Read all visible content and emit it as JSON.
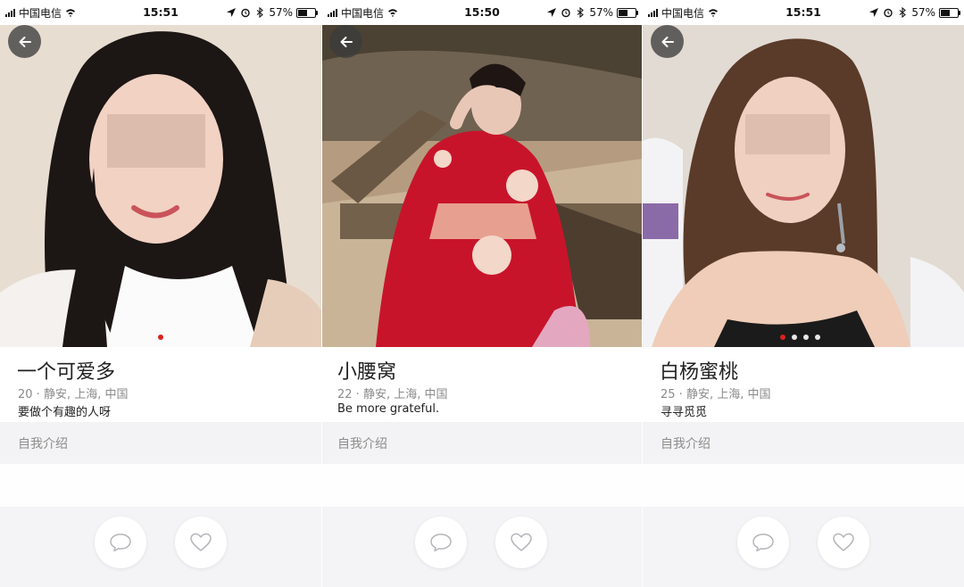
{
  "screens": [
    {
      "status": {
        "carrier": "中国电信",
        "time": "15:51",
        "battery": "57%",
        "battery_level": 0.57
      },
      "icons": {
        "back": "arrow-left-icon",
        "chat": "chat-bubble-icon",
        "like": "heart-icon"
      },
      "profile": {
        "name": "一个可爱多",
        "meta": "20 · 静安, 上海, 中国",
        "bio": "要做个有趣的人呀",
        "intro_label": "自我介绍"
      },
      "photo_dots": {
        "count": 1,
        "active": 0
      }
    },
    {
      "status": {
        "carrier": "中国电信",
        "time": "15:50",
        "battery": "57%",
        "battery_level": 0.57
      },
      "icons": {
        "back": "arrow-left-icon",
        "chat": "chat-bubble-icon",
        "like": "heart-icon"
      },
      "profile": {
        "name": "小腰窝",
        "meta": "22 · 静安, 上海, 中国",
        "bio": "Be more grateful.",
        "intro_label": "自我介绍"
      },
      "photo_dots": {
        "count": 0,
        "active": -1
      }
    },
    {
      "status": {
        "carrier": "中国电信",
        "time": "15:51",
        "battery": "57%",
        "battery_level": 0.57
      },
      "icons": {
        "back": "arrow-left-icon",
        "chat": "chat-bubble-icon",
        "like": "heart-icon"
      },
      "profile": {
        "name": "白杨蜜桃",
        "meta": "25 · 静安, 上海, 中国",
        "bio": "寻寻觅觅",
        "intro_label": "自我介绍"
      },
      "photo_dots": {
        "count": 4,
        "active": 0
      }
    }
  ],
  "colors": {
    "accent": "#d9231d",
    "intro_bg": "#f3f3f5",
    "bottom_bg": "#f4f4f6"
  }
}
